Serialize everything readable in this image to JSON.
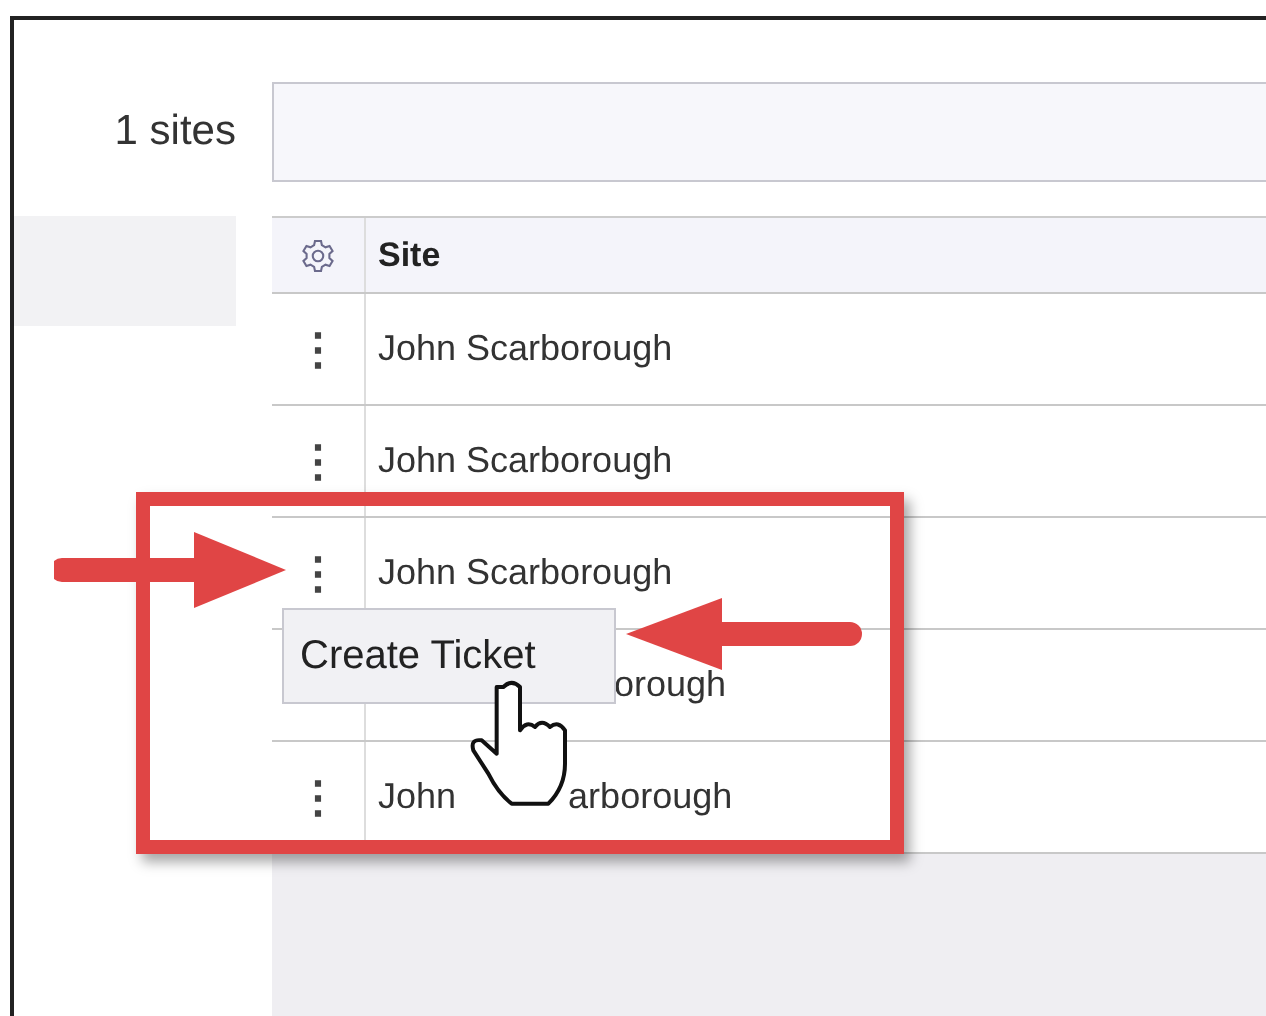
{
  "header": {
    "count_label": "1 sites"
  },
  "table": {
    "column_header": "Site",
    "rows": [
      {
        "site_parts": [
          "John Scarborough"
        ],
        "menu": "⋮"
      },
      {
        "site_parts": [
          "John Scarborough"
        ],
        "menu": "⋮"
      },
      {
        "site_parts": [
          "John Scarborough"
        ],
        "menu": "⋮"
      },
      {
        "site_parts": [
          "orough"
        ],
        "kind": "under_popup"
      },
      {
        "site_parts": [
          "John",
          "arborough"
        ],
        "menu": "⋮",
        "kind": "under_cursor"
      }
    ]
  },
  "popup": {
    "label": "Create Ticket"
  }
}
